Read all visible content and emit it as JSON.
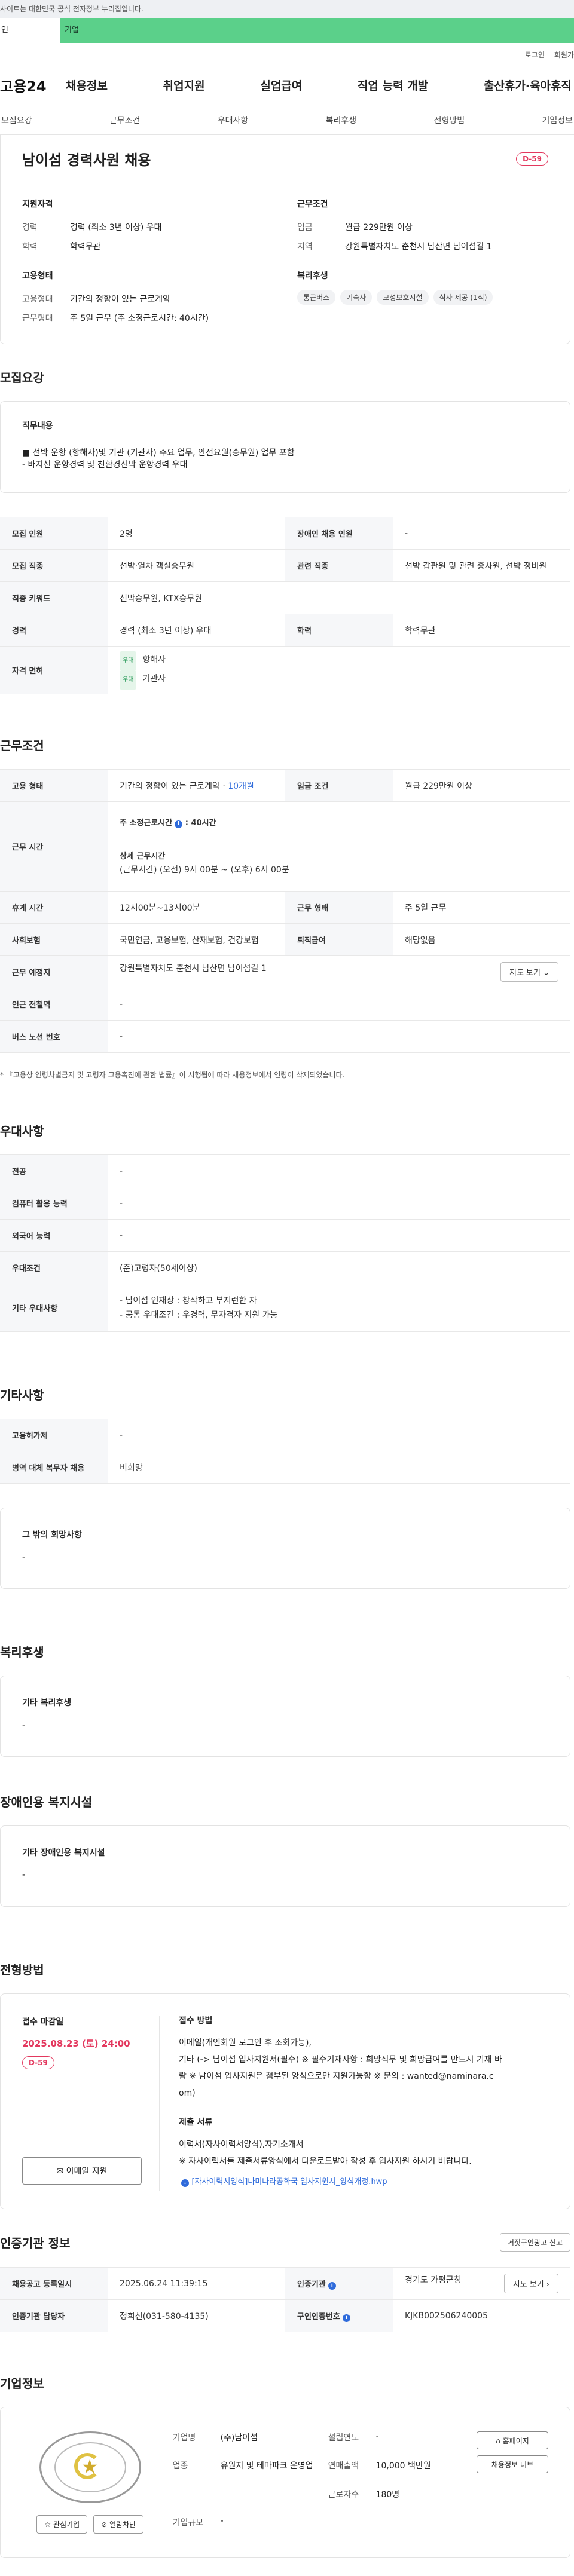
{
  "topbar": {
    "text": "사이트는 대한민국 공식 전자정부 누리집입니다."
  },
  "segments": {
    "individual": "인",
    "company": "기업"
  },
  "util": {
    "login": "로그인",
    "signup": "회원가"
  },
  "gnb": {
    "logo": "고용24",
    "menu": [
      "채용정보",
      "취업지원",
      "실업급여",
      "직업 능력 개발",
      "출산휴가·육아휴직"
    ]
  },
  "tabs": [
    "모집요강",
    "근무조건",
    "우대사항",
    "복리후생",
    "전형방법",
    "기업정보"
  ],
  "summary": {
    "title": "남이섬 경력사원 채용",
    "dday": "D-59",
    "qualification": {
      "heading": "지원자격",
      "rows": [
        [
          "경력",
          "경력 (최소 3년 이상) 우대"
        ],
        [
          "학력",
          "학력무관"
        ]
      ]
    },
    "conditions": {
      "heading": "근무조건",
      "rows": [
        [
          "임금",
          "월급 229만원 이상"
        ],
        [
          "지역",
          "강원특별자치도 춘천시 남산면 남이섬길 1"
        ]
      ]
    },
    "employment": {
      "heading": "고용형태",
      "rows": [
        [
          "고용형태",
          "기간의 정함이 있는 근로계약"
        ],
        [
          "근무형태",
          "주 5일 근무 (주 소정근로시간: 40시간)"
        ]
      ]
    },
    "welfare": {
      "heading": "복리후생",
      "chips": [
        "통근버스",
        "기숙사",
        "모성보호시설",
        "식사 제공 (1식)"
      ]
    }
  },
  "recruit": {
    "title": "모집요강",
    "duty_heading": "직무내용",
    "duty_lines": [
      "■ 선박 운항 (항해사)및 기관 (기관사) 주요 업무, 안전요원(승무원) 업무 포함",
      "- 바지선 운항경력 및 친환경선박 운항경력 우대"
    ],
    "rows": [
      [
        "모집 인원",
        "2명",
        "장애인 채용 인원",
        "-"
      ],
      [
        "모집 직종",
        "선박·열차 객실승무원",
        "관련 직종",
        "선박 갑판원 및 관련 종사원, 선박 정비원"
      ],
      [
        "직종 키워드",
        "선박승무원, KTX승무원",
        "",
        ""
      ],
      [
        "경력",
        "경력 (최소 3년 이상) 우대",
        "학력",
        "학력무관"
      ]
    ],
    "license_key": "자격 면허",
    "licenses": [
      {
        "badge": "우대",
        "name": "항해사"
      },
      {
        "badge": "우대",
        "name": "기관사"
      }
    ]
  },
  "work": {
    "title": "근무조건",
    "employment_key": "고용 형태",
    "employment_val": "기간의 정함이 있는 근로계약 · ",
    "employment_months": "10개월",
    "wage_key": "임금 조건",
    "wage_val": "월급 229만원 이상",
    "hours_key": "근무 시간",
    "weekly_label": "주 소정근로시간",
    "weekly_val": "40시간",
    "detail_label": "상세 근무시간",
    "detail_val": "(근무시간) (오전) 9시 00분 ~ (오후) 6시 00분",
    "rows": [
      [
        "휴게 시간",
        "12시00분~13시00분",
        "근무 형태",
        "주 5일 근무"
      ],
      [
        "사회보험",
        "국민연금, 고용보험, 산재보험, 건강보험",
        "퇴직급여",
        "해당없음"
      ]
    ],
    "place_key": "근무 예정지",
    "place_val": "강원특별자치도 춘천시 남산면 남이섬길 1",
    "map_btn": "지도 보기 ⌄",
    "station_key": "인근 전철역",
    "station_val": "-",
    "bus_key": "버스 노선 번호",
    "bus_val": "-",
    "note": "* 『고용상 연령차별금지 및 고령자 고용촉진에 관한 법률』이 시행됨에 따라 채용정보에서 연령이 삭제되었습니다."
  },
  "pref": {
    "title": "우대사항",
    "rows": [
      [
        "전공",
        "-"
      ],
      [
        "컴퓨터 활용 능력",
        "-"
      ],
      [
        "외국어 능력",
        "-"
      ],
      [
        "우대조건",
        "(준)고령자(50세이상)"
      ]
    ],
    "etc_key": "기타 우대사항",
    "etc_lines": [
      "- 남이섬 인재상 : 창작하고 부지런한 자",
      "- 공통 우대조건 : 우경력, 무자격자 지원 가능"
    ]
  },
  "other": {
    "title": "기타사항",
    "rows": [
      [
        "고용허가제",
        "-"
      ],
      [
        "병역 대체 복무자 채용",
        "비희망"
      ]
    ],
    "wish_heading": "그 밖의 희망사항",
    "wish_val": "-"
  },
  "welfare": {
    "title": "복리후생",
    "heading": "기타 복리후생",
    "val": "-"
  },
  "disability": {
    "title": "장애인용 복지시설",
    "heading": "기타 장애인용 복지시설",
    "val": "-"
  },
  "method": {
    "title": "전형방법",
    "deadline_heading": "접수 마감일",
    "deadline": "2025.08.23 (토) 24:00",
    "dday": "D-59",
    "apply_btn": "✉ 이메일 지원",
    "how_heading": "접수 방법",
    "how_lines": [
      "이메일(개인회원 로그인 후 조회가능),",
      "기타 (-> 남이섬 입사지원서(필수)   ※ 필수기재사항 : 희망직무 및 희망급여를 반드시 기재 바",
      "람   ※ 남이섬 입사지원은 첨부된 양식으로만 지원가능함   ※ 문의 : wanted@naminara.c",
      "om)"
    ],
    "docs_heading": "제출 서류",
    "docs_lines": [
      "이력서(자사이력서양식),자기소개서",
      "※ 자사이력서를 제출서류양식에서 다운로드받아 작성 후 입사지원 하시기 바랍니다."
    ],
    "file": "[자사이력서양식]나미나라공화국 입사지원서_양식개정.hwp"
  },
  "cert": {
    "title": "인증기관 정보",
    "report_btn": "거짓구인광고 신고",
    "rows": [
      [
        "채용공고 등록일시",
        "2025.06.24 11:39:15",
        "인증기관",
        "경기도 가평군청"
      ],
      [
        "인증기관 담당자",
        "정희선(031-580-4135)",
        "구인인증번호",
        "KJKB002506240005"
      ]
    ],
    "map_btn": "지도 보기 ›"
  },
  "company": {
    "title": "기업정보",
    "fav_btn": "☆ 관심기업",
    "block_btn": "⊘ 열람차단",
    "name_key": "기업명",
    "name_val": "(주)남이섬",
    "founded_key": "설립연도",
    "founded_val": "-",
    "industry_key": "업종",
    "industry_val": "유원지 및 테마파크 운영업",
    "sales_key": "연매출액",
    "sales_val": "10,000 백만원",
    "staff_key": "근로자수",
    "staff_val": "180명",
    "size_key": "기업규모",
    "size_val": "-",
    "home_btn": "⌂ 홈페이지",
    "more_btn": "채용정보 더보"
  }
}
